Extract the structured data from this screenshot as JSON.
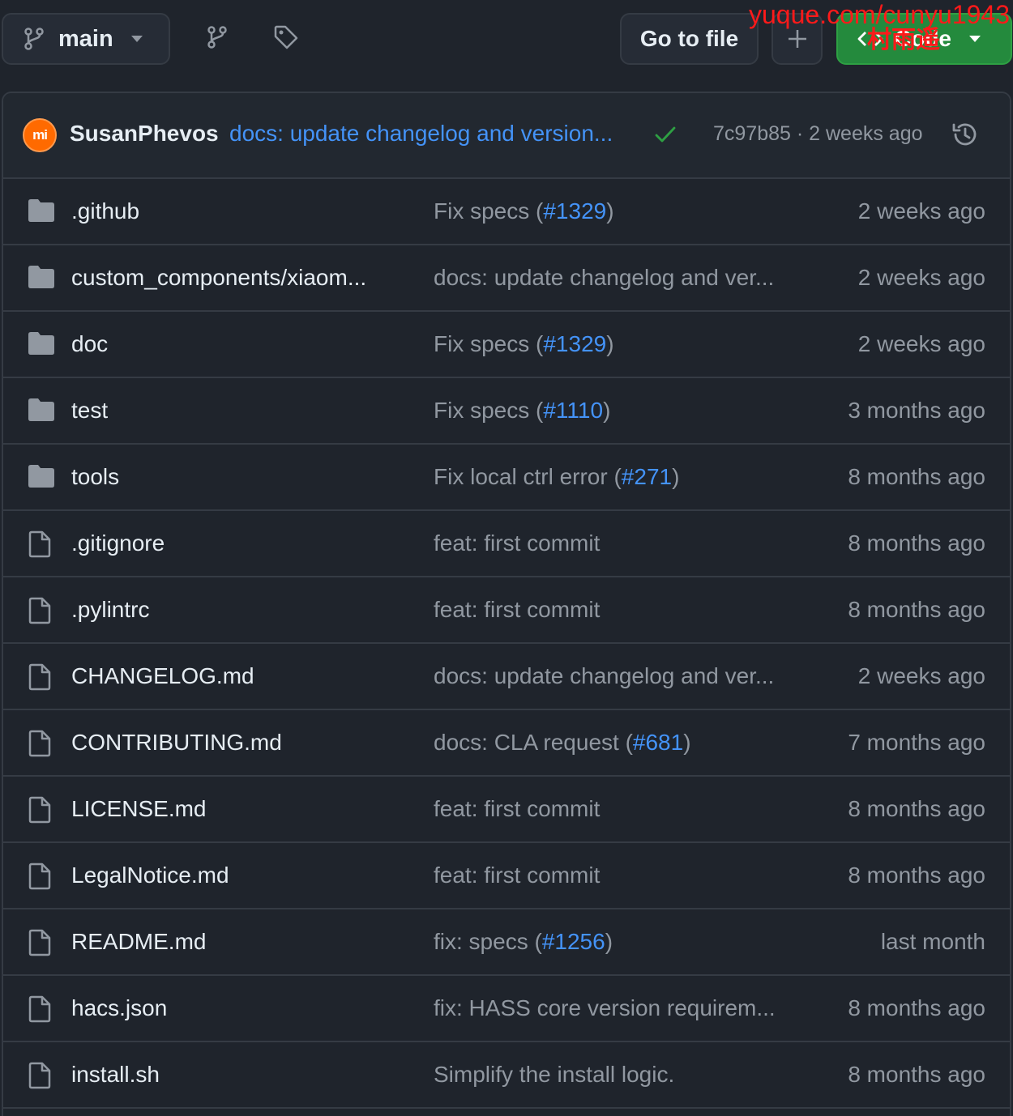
{
  "toolbar": {
    "branch": "main",
    "goto_file": "Go to file",
    "code": "Code"
  },
  "watermark": {
    "line1": "yuque.com/cunyu1943",
    "line2": "村雨遥"
  },
  "latest_commit": {
    "avatar_text": "mi",
    "author": "SusanPhevos",
    "message": "docs: update changelog and version...",
    "sha_time": "7c97b85 · 2 weeks ago"
  },
  "colors": {
    "background": "#1f242c",
    "border": "#353b44",
    "link": "#4493f8",
    "muted": "#9198a1",
    "success": "#2ea043",
    "avatar": "#ff6a00"
  },
  "files": [
    {
      "name": ".github",
      "type": "folder",
      "msg": "Fix specs (",
      "pr": "#1329",
      "msg_end": ")",
      "when": "2 weeks ago"
    },
    {
      "name": "custom_components/xiaom...",
      "type": "folder",
      "msg": "docs: update changelog and ver...",
      "pr": "",
      "msg_end": "",
      "when": "2 weeks ago"
    },
    {
      "name": "doc",
      "type": "folder",
      "msg": "Fix specs (",
      "pr": "#1329",
      "msg_end": ")",
      "when": "2 weeks ago"
    },
    {
      "name": "test",
      "type": "folder",
      "msg": "Fix specs (",
      "pr": "#1110",
      "msg_end": ")",
      "when": "3 months ago"
    },
    {
      "name": "tools",
      "type": "folder",
      "msg": "Fix local ctrl error (",
      "pr": "#271",
      "msg_end": ")",
      "when": "8 months ago"
    },
    {
      "name": ".gitignore",
      "type": "file",
      "msg": "feat: first commit",
      "pr": "",
      "msg_end": "",
      "when": "8 months ago"
    },
    {
      "name": ".pylintrc",
      "type": "file",
      "msg": "feat: first commit",
      "pr": "",
      "msg_end": "",
      "when": "8 months ago"
    },
    {
      "name": "CHANGELOG.md",
      "type": "file",
      "msg": "docs: update changelog and ver...",
      "pr": "",
      "msg_end": "",
      "when": "2 weeks ago"
    },
    {
      "name": "CONTRIBUTING.md",
      "type": "file",
      "msg": "docs: CLA request (",
      "pr": "#681",
      "msg_end": ")",
      "when": "7 months ago"
    },
    {
      "name": "LICENSE.md",
      "type": "file",
      "msg": "feat: first commit",
      "pr": "",
      "msg_end": "",
      "when": "8 months ago"
    },
    {
      "name": "LegalNotice.md",
      "type": "file",
      "msg": "feat: first commit",
      "pr": "",
      "msg_end": "",
      "when": "8 months ago"
    },
    {
      "name": "README.md",
      "type": "file",
      "msg": "fix: specs (",
      "pr": "#1256",
      "msg_end": ")",
      "when": "last month"
    },
    {
      "name": "hacs.json",
      "type": "file",
      "msg": "fix: HASS core version requirem...",
      "pr": "",
      "msg_end": "",
      "when": "8 months ago"
    },
    {
      "name": "install.sh",
      "type": "file",
      "msg": "Simplify the install logic.",
      "pr": "",
      "msg_end": "",
      "when": "8 months ago"
    }
  ]
}
